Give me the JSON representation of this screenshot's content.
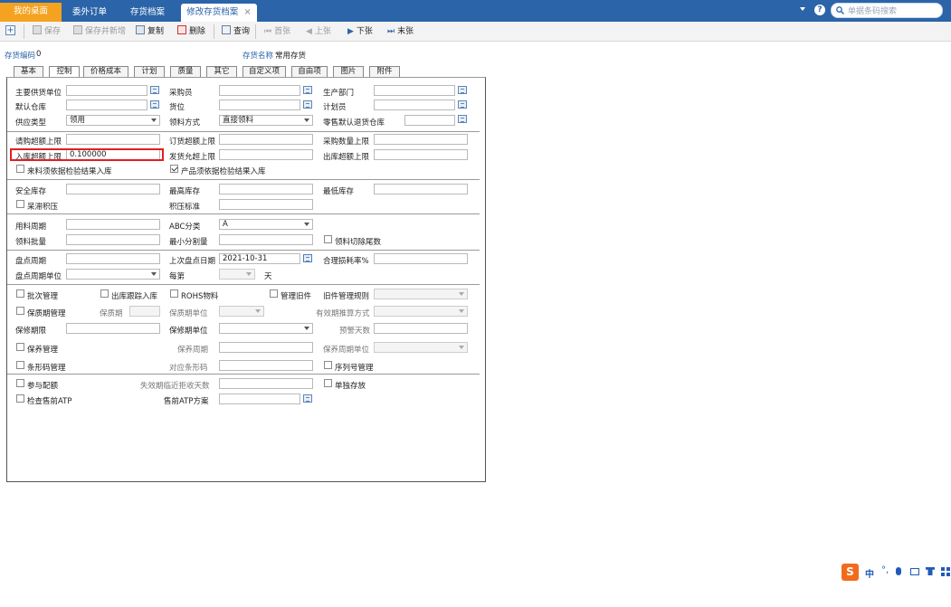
{
  "tabs": {
    "home": "我的桌面",
    "items": [
      "委外订单",
      "存货档案"
    ],
    "active": "修改存货档案",
    "close": "×"
  },
  "search": {
    "placeholder": "单据条码搜索"
  },
  "toolbar": {
    "save": "保存",
    "save_new": "保存并新增",
    "copy": "复制",
    "delete": "删除",
    "query": "查询",
    "first": "首张",
    "prev": "上张",
    "next": "下张",
    "last": "末张"
  },
  "header": {
    "code_label": "存货编码",
    "code_value": "0",
    "name_label": "存货名称",
    "name_value": "常用存货"
  },
  "form_tabs": [
    "基本",
    "控制",
    "价格成本",
    "计划",
    "质量",
    "其它",
    "自定义项",
    "自由项",
    "图片",
    "附件"
  ],
  "form": {
    "supplier_label": "主要供货单位",
    "buyer_label": "采购员",
    "dept_label": "生产部门",
    "warehouse_label": "默认仓库",
    "location_label": "货位",
    "planner_label": "计划员",
    "supply_type_label": "供应类型",
    "supply_type_value": "领用",
    "issue_method_label": "领料方式",
    "issue_method_value": "直接领料",
    "retail_return_label": "零售默认退货仓库",
    "req_over_label": "请购超额上限",
    "order_over_label": "订货超额上限",
    "purchase_qty_label": "采购数量上限",
    "inbound_over_label": "入库超额上限",
    "inbound_over_value": "0.100000",
    "ship_over_label": "发货允超上限",
    "outbound_over_label": "出库超额上限",
    "incoming_check_label": "来料须依据检验结果入库",
    "product_check_label": "产品须依据检验结果入库",
    "safety_stock_label": "安全库存",
    "max_stock_label": "最高库存",
    "min_stock_label": "最低库存",
    "slow_moving_label": "呆滞积压",
    "overstock_label": "积压标准",
    "usage_cycle_label": "用料周期",
    "abc_label": "ABC分类",
    "abc_value": "A",
    "issue_batch_label": "领料批量",
    "min_split_label": "最小分割量",
    "cut_tail_label": "领料切除尾数",
    "count_cycle_label": "盘点周期",
    "last_count_label": "上次盘点日期",
    "last_count_value": "2021-10-31",
    "loss_rate_label": "合理损耗率%",
    "count_unit_label": "盘点周期单位",
    "every_label": "每第",
    "day_label": "天",
    "batch_mgmt_label": "批次管理",
    "outbound_track_label": "出库跟踪入库",
    "rohs_label": "ROHS物料",
    "old_parts_label": "管理旧件",
    "old_rule_label": "旧件管理规则",
    "shelf_mgmt_label": "保质期管理",
    "shelf_period_label": "保质期",
    "shelf_unit_label": "保质期单位",
    "expiry_calc_label": "有效期推算方式",
    "warranty_label": "保修期限",
    "warranty_unit_label": "保修期单位",
    "warn_days_label": "预警天数",
    "maint_label": "保养管理",
    "maint_cycle_label": "保养周期",
    "maint_unit_label": "保养周期单位",
    "barcode_label": "条形码管理",
    "barcode_map_label": "对应条形码",
    "serial_label": "序列号管理",
    "quota_label": "参与配额",
    "reject_days_label": "失效期临近拒收天数",
    "separate_label": "单独存放",
    "atp_check_label": "检查售前ATP",
    "atp_plan_label": "售前ATP方案"
  },
  "ime": {
    "label": "中"
  },
  "colors": {
    "topbar": "#2b64a8",
    "home_tab": "#f4a21f",
    "highlight": "#e02020",
    "link": "#2b64a8"
  }
}
